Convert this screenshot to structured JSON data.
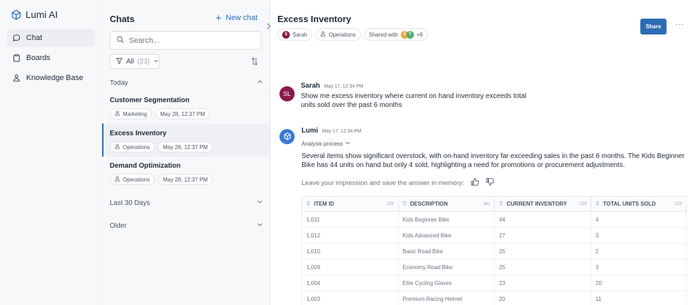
{
  "app": {
    "name": "Lumi AI"
  },
  "nav": {
    "items": [
      {
        "label": "Chat"
      },
      {
        "label": "Boards"
      },
      {
        "label": "Knowledge Base"
      }
    ]
  },
  "chats": {
    "title": "Chats",
    "new_chat": "New chat",
    "search_placeholder": "Search...",
    "filter_label": "All",
    "filter_count": "(23)",
    "groups": {
      "today": "Today",
      "last30": "Last 30 Days",
      "older": "Older"
    },
    "items": [
      {
        "title": "Customer Segmentation",
        "tag": "Marketing",
        "date": "May 28, 12:37 PM"
      },
      {
        "title": "Excess Inventory",
        "tag": "Operations",
        "date": "May 28, 12:37 PM"
      },
      {
        "title": "Demand Optimization",
        "tag": "Operations",
        "date": "May 28, 12:37 PM"
      }
    ]
  },
  "main": {
    "title": "Excess Inventory",
    "owner": "Sarah",
    "owner_initial": "S",
    "team": "Operations",
    "shared_with": "Shared with",
    "shared_avatars": [
      "A",
      "T"
    ],
    "shared_more": "+6",
    "share_button": "Share",
    "more": "···"
  },
  "messages": {
    "user": {
      "initials": "SL",
      "name": "Sarah",
      "time": "May 17, 12:34 PM",
      "line1": "Show me excess inventory where current on hand inventory exceeds total",
      "line2": "units sold over the past 6 months"
    },
    "bot": {
      "name": "Lumi",
      "time": "May 17, 12:34 PM",
      "analysis": "Analysis process",
      "line1": "Several items show significant overstock, with on-hand inventory far exceeding sales in the past 6 months. The Kids Beginner",
      "line2": "Bike has 44 units on hand but only 4 sold, highlighting a need for promotions or procurement adjustments.",
      "impression": "Leave your impression and save the answer in memory:"
    }
  },
  "table": {
    "columns": [
      {
        "label": "ITEM ID",
        "type": "123"
      },
      {
        "label": "DESCRIPTION",
        "type": "abc"
      },
      {
        "label": "CURRENT INVENTORY",
        "type": "123"
      },
      {
        "label": "TOTAL UNITS SOLD",
        "type": "123"
      }
    ],
    "rows": [
      [
        "1,011",
        "Kids Beginner Bike",
        "44",
        "4"
      ],
      [
        "1,012",
        "Kids Advanced Bike",
        "27",
        "3"
      ],
      [
        "1,010",
        "Basic Road Bike",
        "25",
        "2"
      ],
      [
        "1,009",
        "Economy Road Bike",
        "25",
        "3"
      ],
      [
        "1,004",
        "Elite Cycling Gloves",
        "23",
        "20"
      ],
      [
        "1,003",
        "Premium Racing Helmet",
        "20",
        "11"
      ]
    ]
  },
  "colors": {
    "accent": "#2d6cb3",
    "user_avatar": "#8b1a4a",
    "bot_avatar": "#3b7ad3",
    "shared_a": "#f0a430",
    "shared_t": "#4caf7a"
  }
}
